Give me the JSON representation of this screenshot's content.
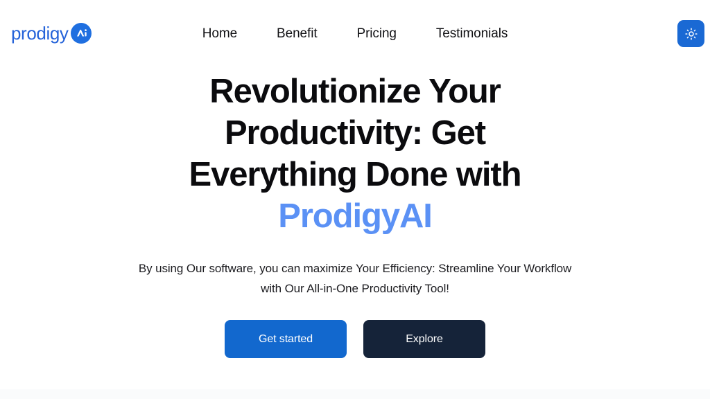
{
  "brand": {
    "word": "prodigy",
    "mark_icon": "ai-circle-icon",
    "mark_text": "Ai"
  },
  "nav": {
    "items": [
      {
        "label": "Home"
      },
      {
        "label": "Benefit"
      },
      {
        "label": "Pricing"
      },
      {
        "label": "Testimonials"
      }
    ]
  },
  "theme_toggle": {
    "icon": "sun-icon",
    "mode": "light"
  },
  "hero": {
    "title_line1": "Revolutionize Your",
    "title_line2": "Productivity: Get",
    "title_line3": "Everything Done with",
    "title_accent": "ProdigyAI",
    "subtitle": "By using Our software, you can maximize Your Efficiency: Streamline Your Workflow with Our All-in-One Productivity Tool!",
    "primary_cta": "Get started",
    "secondary_cta": "Explore"
  },
  "colors": {
    "page_background": "#ffffff",
    "brand_blue": "#2563d9",
    "accent_blue": "#5b91f5",
    "primary_button": "#1268ce",
    "secondary_button": "#152339",
    "toggle_button": "#1a69d4",
    "heading_text": "#0b0b0e",
    "body_text": "#1c1c20",
    "next_section_band": "#fafbfc"
  }
}
